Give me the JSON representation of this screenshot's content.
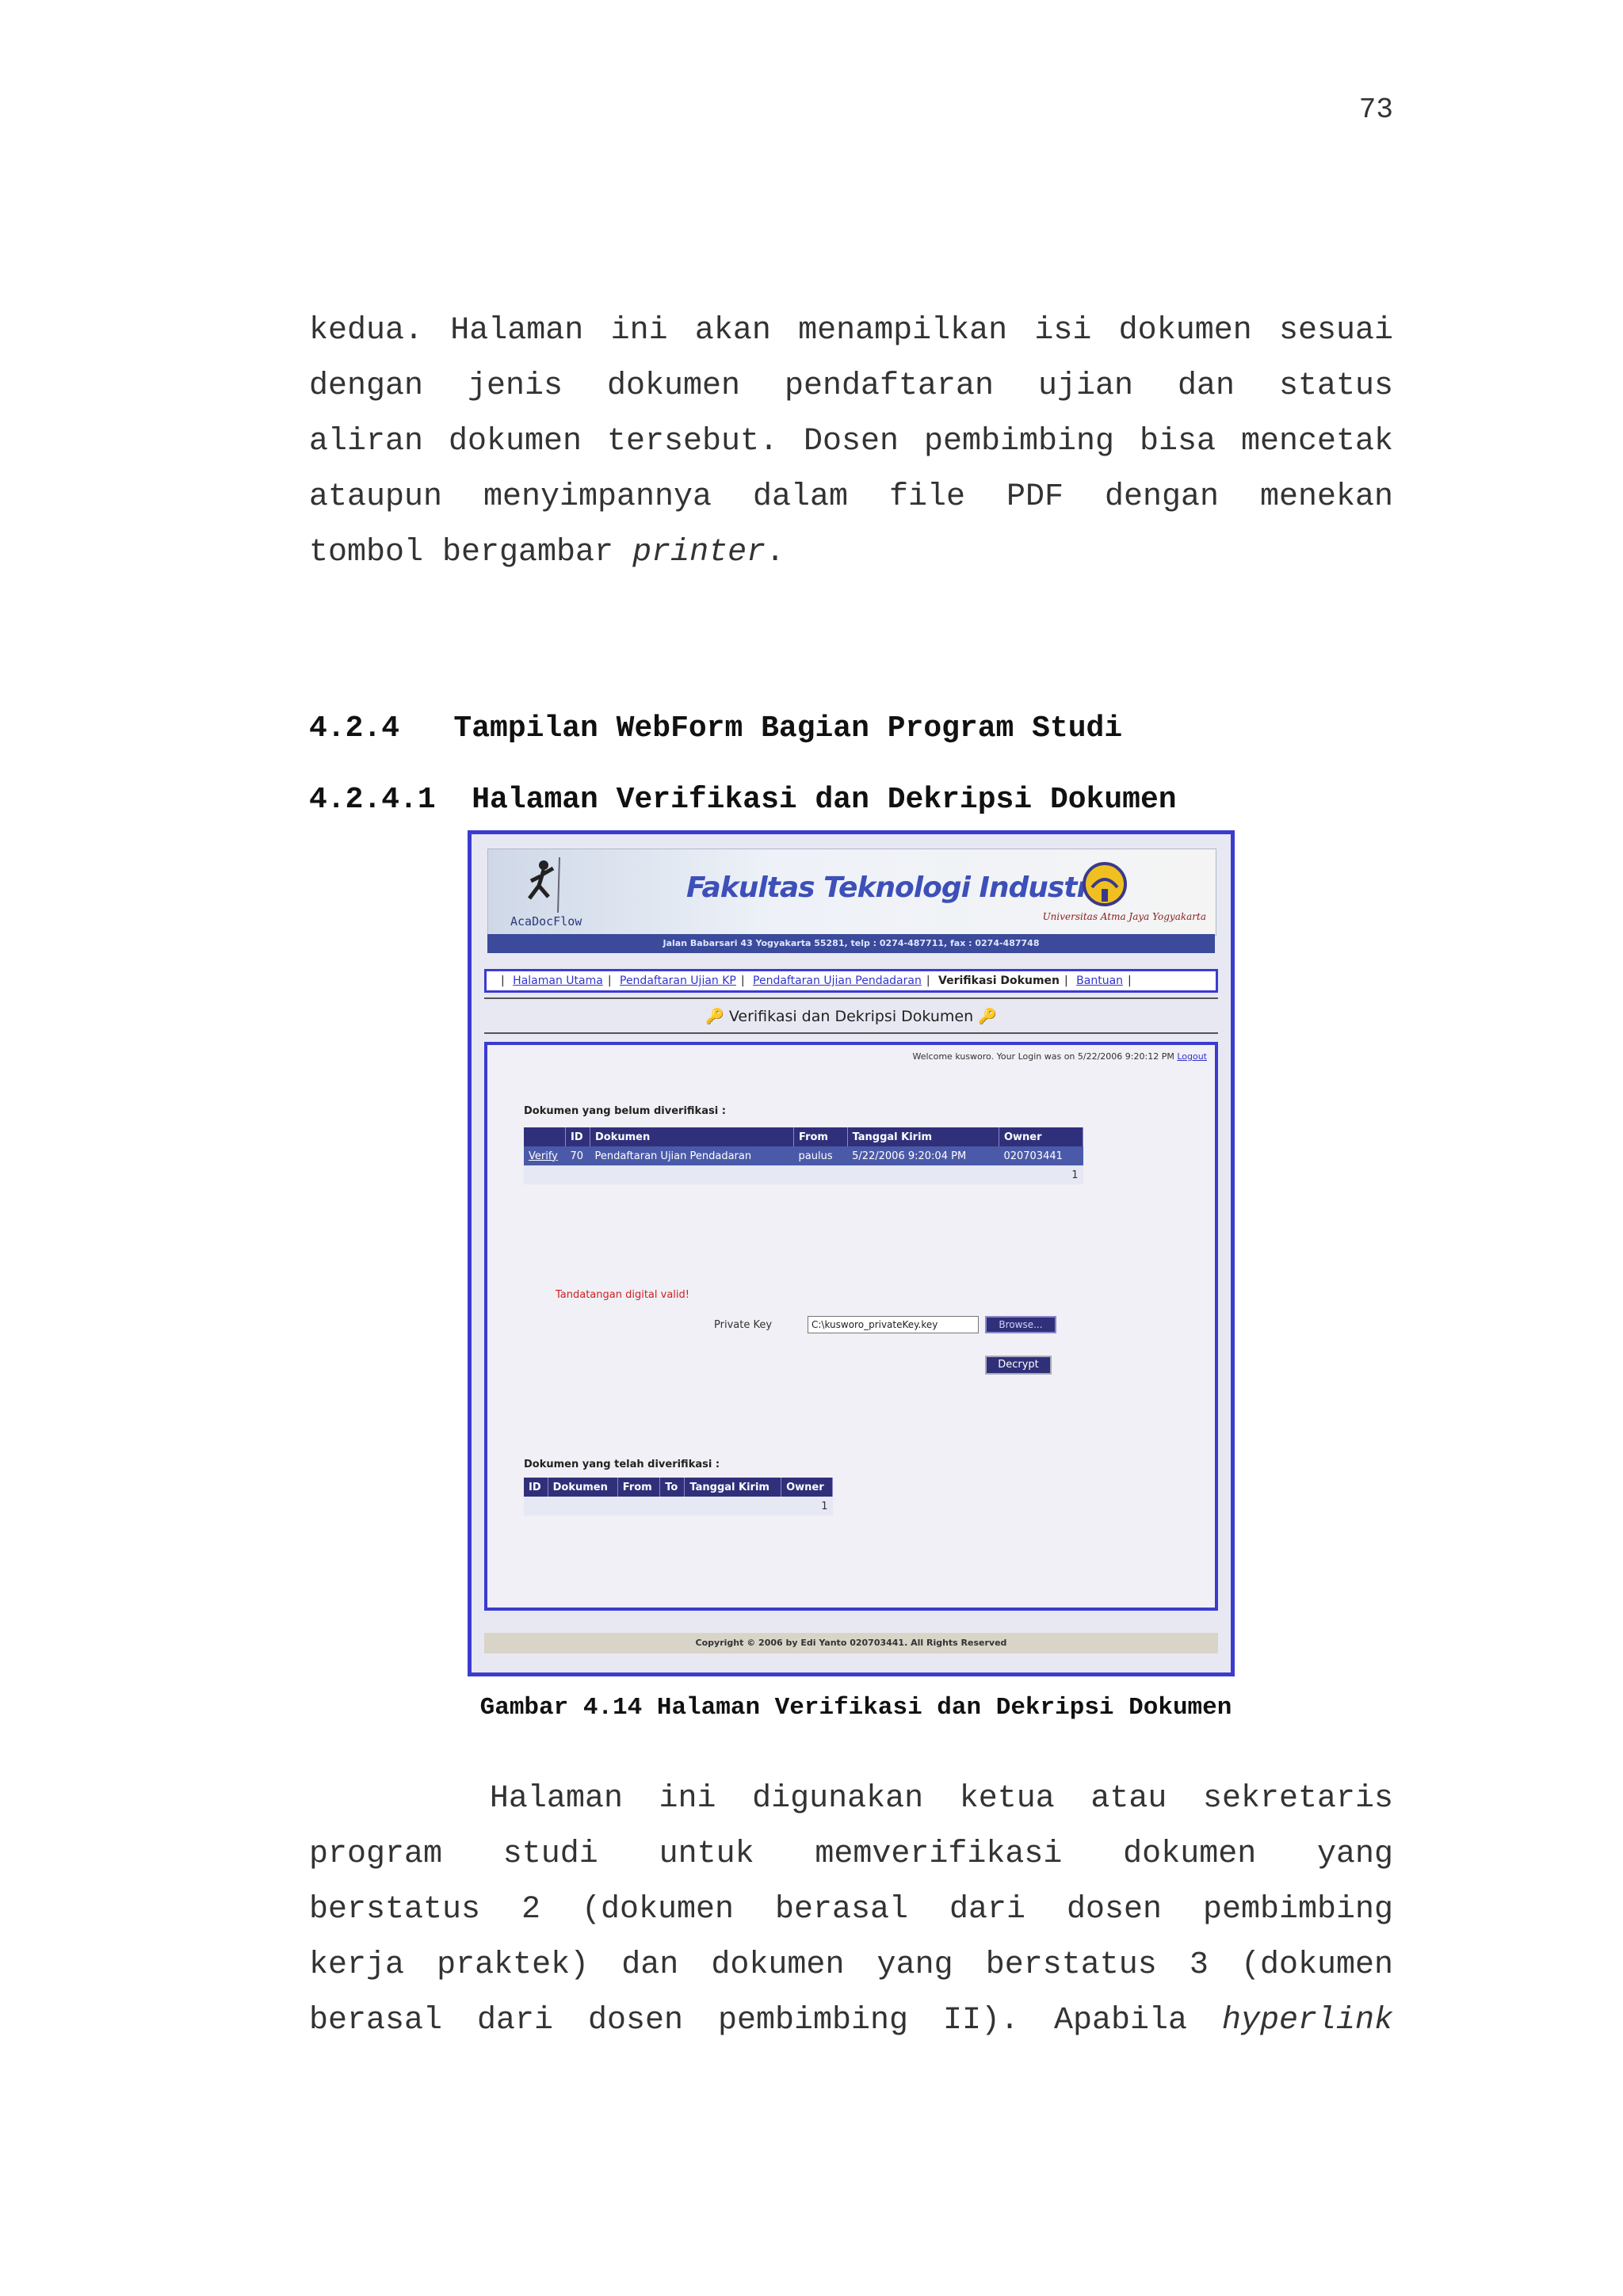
{
  "page_number": "73",
  "para1_lines": [
    "kedua. Halaman ini akan menampilkan isi dokumen sesuai",
    "dengan jenis dokumen pendaftaran ujian dan status",
    "aliran dokumen tersebut. Dosen pembimbing bisa mencetak",
    "ataupun menyimpannya dalam file PDF dengan menekan"
  ],
  "para1_last": {
    "before": "tombol bergambar ",
    "italic": "printer",
    "after": "."
  },
  "heading1": "4.2.4   Tampilan WebForm Bagian Program Studi",
  "heading2": "4.2.4.1  Halaman Verifikasi dan Dekripsi Dokumen",
  "figure": {
    "brand": "AcaDocFlow",
    "title": "Fakultas Teknologi Industri",
    "university": "Universitas Atma Jaya Yogyakarta",
    "address": "Jalan Babarsari 43 Yogyakarta 55281, telp : 0274-487711, fax : 0274-487748",
    "nav": [
      "Halaman Utama",
      "Pendaftaran Ujian KP",
      "Pendaftaran Ujian Pendadaran",
      "Verifikasi Dokumen",
      "Bantuan"
    ],
    "page_title": "Verifikasi dan Dekripsi Dokumen",
    "welcome": "Welcome kusworo. Your Login was on 5/22/2006 9:20:12 PM",
    "logout": "Logout",
    "unverified_label": "Dokumen yang belum diverifikasi :",
    "unverified_headers": [
      "",
      "ID",
      "Dokumen",
      "From",
      "Tanggal Kirim",
      "Owner"
    ],
    "unverified_row": [
      "Verify",
      "70",
      "Pendaftaran Ujian Pendadaran",
      "paulus",
      "5/22/2006 9:20:04 PM",
      "020703441"
    ],
    "pager": "1",
    "signature_msg": "Tandatangan digital valid!",
    "private_key_label": "Private Key",
    "private_key_value": "C:\\kusworo_privateKey.key",
    "browse_label": "Browse...",
    "decrypt_label": "Decrypt",
    "verified_label": "Dokumen yang telah diverifikasi :",
    "verified_headers": [
      "ID",
      "Dokumen",
      "From",
      "To",
      "Tanggal Kirim",
      "Owner"
    ],
    "verified_pager": "1",
    "footer": "Copyright © 2006 by Edi Yanto 020703441. All Rights Reserved"
  },
  "caption": "Gambar 4.14 Halaman Verifikasi dan Dekripsi Dokumen",
  "para2_lines": [
    "     Halaman ini digunakan ketua atau sekretaris",
    "program studi untuk memverifikasi dokumen yang",
    "berstatus 2 (dokumen berasal dari dosen pembimbing",
    "kerja praktek) dan dokumen yang berstatus 3 (dokumen"
  ],
  "para2_last": {
    "before": "berasal dari dosen pembimbing II). Apabila ",
    "italic": "hyperlink"
  },
  "colors": {
    "frame_border": "#3b3bd0",
    "table_header": "#30307a",
    "selected_row": "#4b5aa8",
    "error_text": "#d02020"
  }
}
